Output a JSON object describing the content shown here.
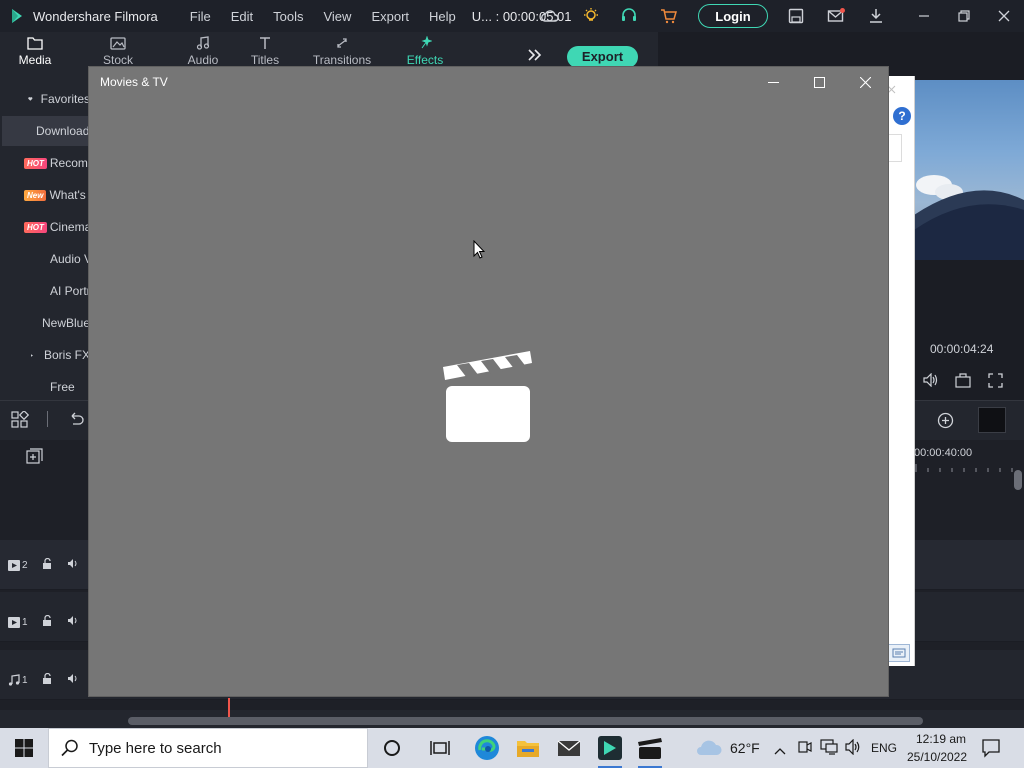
{
  "titlebar": {
    "app_name": "Wondershare Filmora",
    "menus": [
      "File",
      "Edit",
      "Tools",
      "View",
      "Export",
      "Help"
    ],
    "project_name": "U... : 00:00:05:01",
    "login_label": "Login"
  },
  "tooltabs": [
    {
      "label": "Media",
      "icon": "folder-icon"
    },
    {
      "label": "Stock Media",
      "icon": "stock-media-icon"
    },
    {
      "label": "Audio",
      "icon": "music-note-icon"
    },
    {
      "label": "Titles",
      "icon": "titles-icon"
    },
    {
      "label": "Transitions",
      "icon": "transitions-icon"
    },
    {
      "label": "Effects",
      "icon": "effects-icon"
    }
  ],
  "export_label": "Export",
  "library": {
    "items": [
      {
        "label": "Favorites",
        "badge": "",
        "icon": "heart-icon"
      },
      {
        "label": "Downloads",
        "badge": "",
        "icon": "download-icon"
      },
      {
        "label": "Recommended",
        "badge": "HOT"
      },
      {
        "label": "What's New",
        "badge": "New"
      },
      {
        "label": "Cinematic",
        "badge": "HOT"
      },
      {
        "label": "Audio Visualizer",
        "badge": ""
      },
      {
        "label": "AI Portrait",
        "badge": ""
      },
      {
        "label": "NewBlue FX",
        "badge": "",
        "expandable": true
      },
      {
        "label": "Boris FX",
        "badge": "",
        "expandable": true
      },
      {
        "label": "Free",
        "badge": ""
      }
    ]
  },
  "preview": {
    "timecode": "00:00:04:24"
  },
  "timeline": {
    "ruler_time": "00:00:40:00",
    "tracks": [
      {
        "label": "2",
        "type": "video"
      },
      {
        "label": "1",
        "type": "video"
      },
      {
        "label": "1",
        "type": "audio"
      }
    ]
  },
  "movies_tv": {
    "title": "Movies & TV"
  },
  "taskbar": {
    "search_placeholder": "Type here to search",
    "temperature": "62°F",
    "language": "ENG",
    "time": "12:19 am",
    "date": "25/10/2022"
  },
  "colors": {
    "accent": "#3fd7b4",
    "window_gray": "#767676",
    "taskbar": "#d9dde6"
  }
}
